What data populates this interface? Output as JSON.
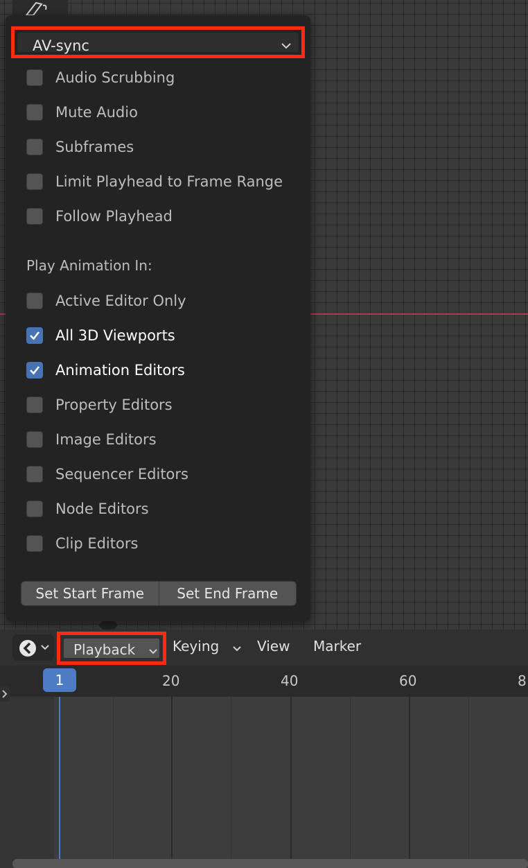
{
  "popup": {
    "sync_mode": "AV-sync",
    "options": [
      {
        "label": "Audio Scrubbing",
        "checked": false
      },
      {
        "label": "Mute Audio",
        "checked": false
      },
      {
        "label": "Subframes",
        "checked": false
      },
      {
        "label": "Limit Playhead to Frame Range",
        "checked": false
      },
      {
        "label": "Follow Playhead",
        "checked": false
      }
    ],
    "play_in_label": "Play Animation In:",
    "play_in": [
      {
        "label": "Active Editor Only",
        "checked": false
      },
      {
        "label": "All 3D Viewports",
        "checked": true
      },
      {
        "label": "Animation Editors",
        "checked": true
      },
      {
        "label": "Property Editors",
        "checked": false
      },
      {
        "label": "Image Editors",
        "checked": false
      },
      {
        "label": "Sequencer Editors",
        "checked": false
      },
      {
        "label": "Node Editors",
        "checked": false
      },
      {
        "label": "Clip Editors",
        "checked": false
      }
    ],
    "buttons": {
      "set_start": "Set Start Frame",
      "set_end": "Set End Frame"
    }
  },
  "header": {
    "editor_icon": "clock-icon",
    "menus": {
      "playback": "Playback",
      "keying": "Keying",
      "view": "View",
      "marker": "Marker"
    }
  },
  "ruler": {
    "current_frame": "1",
    "ticks": [
      "20",
      "40",
      "60",
      "8"
    ]
  },
  "colors": {
    "accent": "#4772b3",
    "highlight_box": "#ff2a12",
    "background": "#3a3a3a",
    "popup": "#232323"
  }
}
